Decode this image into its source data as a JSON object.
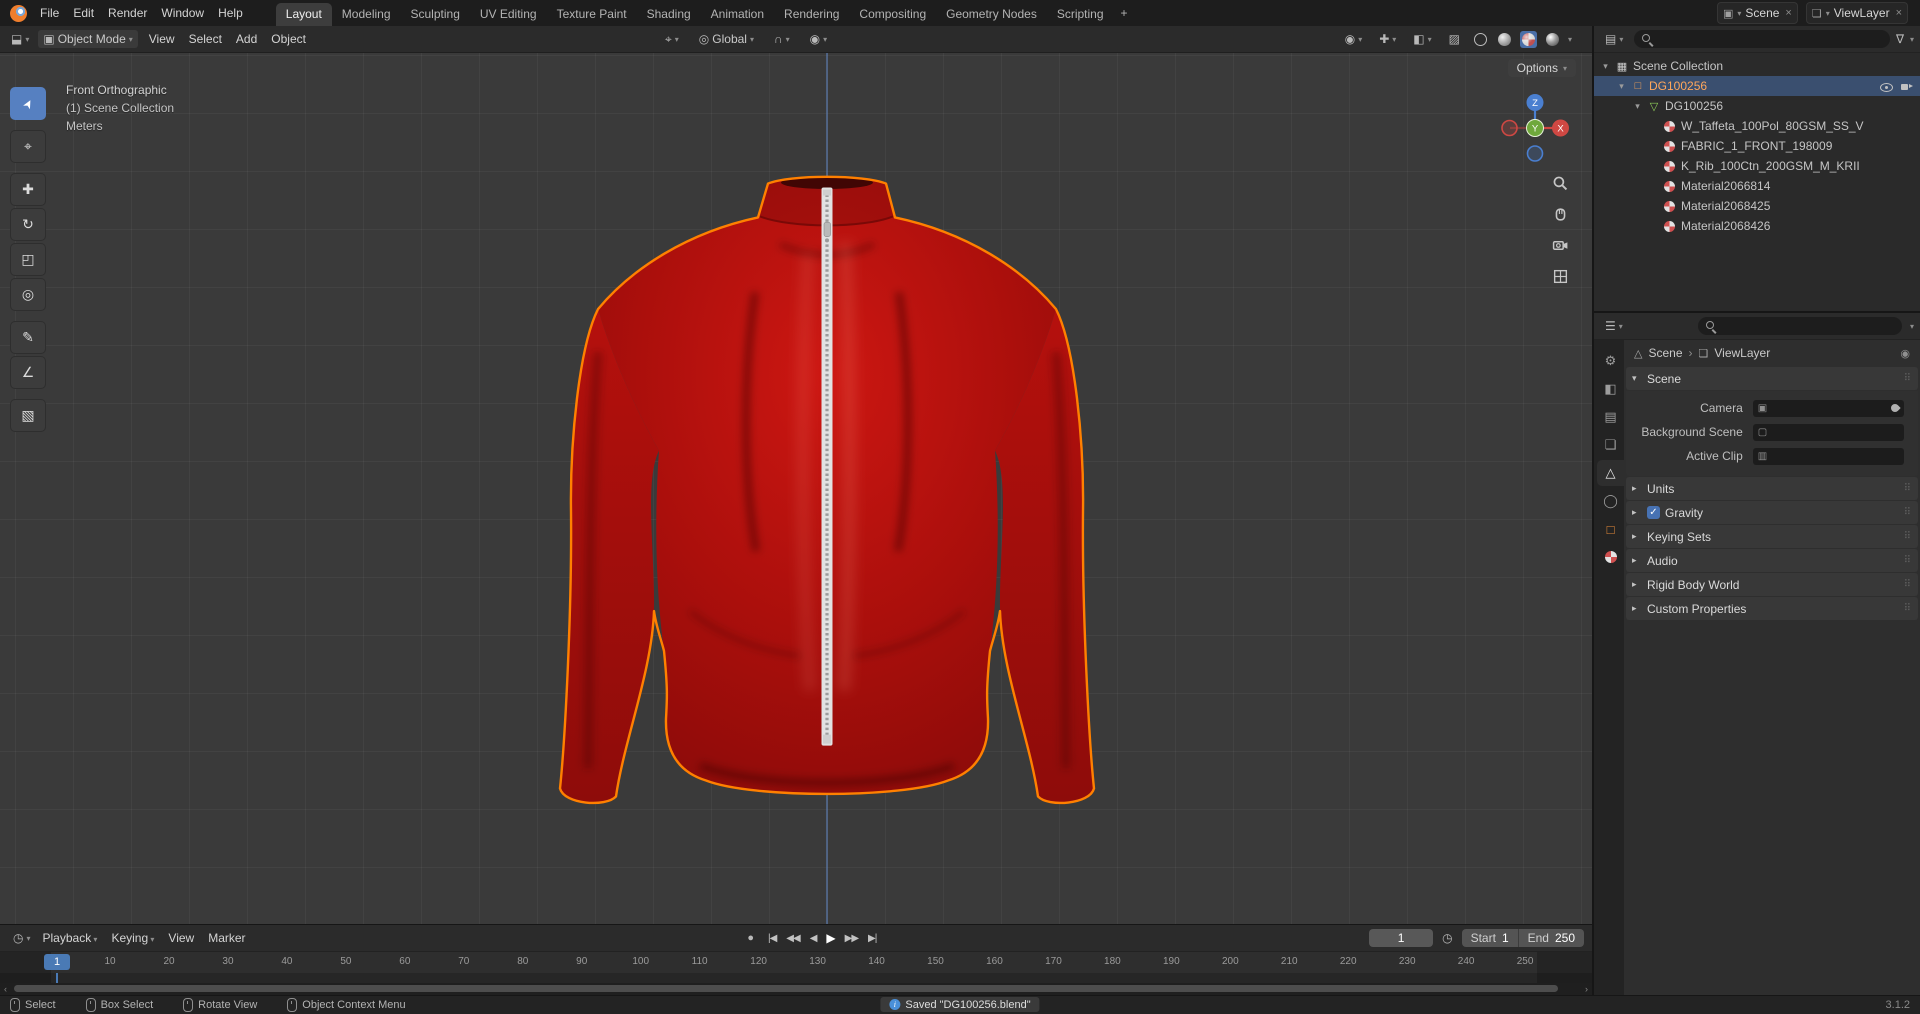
{
  "topbar": {
    "menus": [
      "File",
      "Edit",
      "Render",
      "Window",
      "Help"
    ],
    "workspaces": [
      {
        "label": "Layout",
        "active": true
      },
      {
        "label": "Modeling"
      },
      {
        "label": "Sculpting"
      },
      {
        "label": "UV Editing"
      },
      {
        "label": "Texture Paint"
      },
      {
        "label": "Shading"
      },
      {
        "label": "Animation"
      },
      {
        "label": "Rendering"
      },
      {
        "label": "Compositing"
      },
      {
        "label": "Geometry Nodes"
      },
      {
        "label": "Scripting"
      }
    ],
    "add_workspace": "+",
    "scene_selector": {
      "label": "Scene",
      "unlink": "×"
    },
    "viewlayer_selector": {
      "label": "ViewLayer",
      "unlink": "×"
    }
  },
  "viewport_header": {
    "mode": "Object Mode",
    "menus": [
      "View",
      "Select",
      "Add",
      "Object"
    ],
    "orientation": "Global",
    "options": "Options"
  },
  "tools": [
    {
      "name": "select-box",
      "glyph": "➤",
      "active": true
    },
    {
      "name": "cursor",
      "glyph": "⌖",
      "gap": true
    },
    {
      "name": "move",
      "glyph": "✚",
      "gap": true
    },
    {
      "name": "rotate",
      "glyph": "↻"
    },
    {
      "name": "scale",
      "glyph": "◰"
    },
    {
      "name": "transform",
      "glyph": "◎"
    },
    {
      "name": "annotate",
      "glyph": "✎",
      "gap": true
    },
    {
      "name": "measure",
      "glyph": "∠"
    },
    {
      "name": "add-cube",
      "glyph": "▧",
      "gap": true
    }
  ],
  "viewport": {
    "view_name": "Front Orthographic",
    "collection": "(1) Scene Collection",
    "units": "Meters",
    "gizmo": {
      "x": "X",
      "y": "Y",
      "z": "Z"
    }
  },
  "outliner": {
    "rows": [
      {
        "level": 0,
        "arrow": "▾",
        "icon": "collection",
        "label": "Scene Collection"
      },
      {
        "level": 1,
        "arrow": "▾",
        "icon": "object",
        "label": "DG100256",
        "selected": true,
        "active": true,
        "eye": true,
        "camera": true
      },
      {
        "level": 2,
        "arrow": "▾",
        "icon": "mesh",
        "label": "DG100256"
      },
      {
        "level": 3,
        "icon": "material",
        "label": "W_Taffeta_100Pol_80GSM_SS_V"
      },
      {
        "level": 3,
        "icon": "material",
        "label": "FABRIC_1_FRONT_198009"
      },
      {
        "level": 3,
        "icon": "material",
        "label": "K_Rib_100Ctn_200GSM_M_KRII"
      },
      {
        "level": 3,
        "icon": "material",
        "label": "Material2066814"
      },
      {
        "level": 3,
        "icon": "material",
        "label": "Material2068425"
      },
      {
        "level": 3,
        "icon": "material",
        "label": "Material2068426"
      }
    ]
  },
  "properties": {
    "breadcrumb": {
      "scene": "Scene",
      "viewlayer": "ViewLayer"
    },
    "tabs": [
      {
        "name": "tool",
        "glyph": "⚙"
      },
      {
        "name": "render",
        "glyph": "◧"
      },
      {
        "name": "output",
        "glyph": "▤"
      },
      {
        "name": "view-layer",
        "glyph": "❏"
      },
      {
        "name": "scene",
        "glyph": "△",
        "active": true
      },
      {
        "name": "world",
        "glyph": "◯"
      },
      {
        "name": "object",
        "glyph": "□",
        "tint": "obj"
      },
      {
        "name": "material",
        "glyph": "",
        "material_icon": true
      }
    ],
    "panels": [
      {
        "label": "Scene",
        "expanded": true,
        "rows": [
          {
            "label": "Camera",
            "icon": "camera",
            "eyedropper": true
          },
          {
            "label": "Background Scene",
            "icon": "scene"
          },
          {
            "label": "Active Clip",
            "icon": "clip"
          }
        ]
      },
      {
        "label": "Units"
      },
      {
        "label": "Gravity",
        "checkbox": true,
        "checked": true,
        "check_glyph": "✓"
      },
      {
        "label": "Keying Sets"
      },
      {
        "label": "Audio"
      },
      {
        "label": "Rigid Body World"
      },
      {
        "label": "Custom Properties"
      }
    ]
  },
  "timeline": {
    "menus": [
      {
        "label": "Playback",
        "caret": true
      },
      {
        "label": "Keying",
        "caret": true
      },
      {
        "label": "View"
      },
      {
        "label": "Marker"
      }
    ],
    "transport": [
      {
        "name": "jump-to-start",
        "glyph": "|◀"
      },
      {
        "name": "jump-to-prev-keyframe",
        "glyph": "◀◀"
      },
      {
        "name": "play-reverse",
        "glyph": "◀"
      },
      {
        "name": "play",
        "glyph": "▶",
        "play": true
      },
      {
        "name": "jump-to-next-keyframe",
        "glyph": "▶▶"
      },
      {
        "name": "jump-to-end",
        "glyph": "▶|"
      }
    ],
    "current_frame": "1",
    "playhead_frame": 1,
    "start_label": "Start",
    "start_value": "1",
    "end_label": "End",
    "end_value": "250",
    "ruler_frames": [
      10,
      20,
      30,
      40,
      50,
      60,
      70,
      80,
      90,
      100,
      110,
      120,
      130,
      140,
      150,
      160,
      170,
      180,
      190,
      200,
      210,
      220,
      230,
      240,
      250
    ]
  },
  "statusbar": {
    "hints": [
      {
        "label": "Select"
      },
      {
        "label": "Box Select"
      },
      {
        "label": "Rotate View"
      },
      {
        "label": "Object Context Menu"
      }
    ],
    "saved": "Saved \"DG100256.blend\"",
    "version": "3.1.2"
  },
  "colors": {
    "selection_outline": "#ff8000",
    "accent_blue": "#4772b3",
    "active_object_text": "#ffa75c",
    "garment_red": "#b01010"
  }
}
